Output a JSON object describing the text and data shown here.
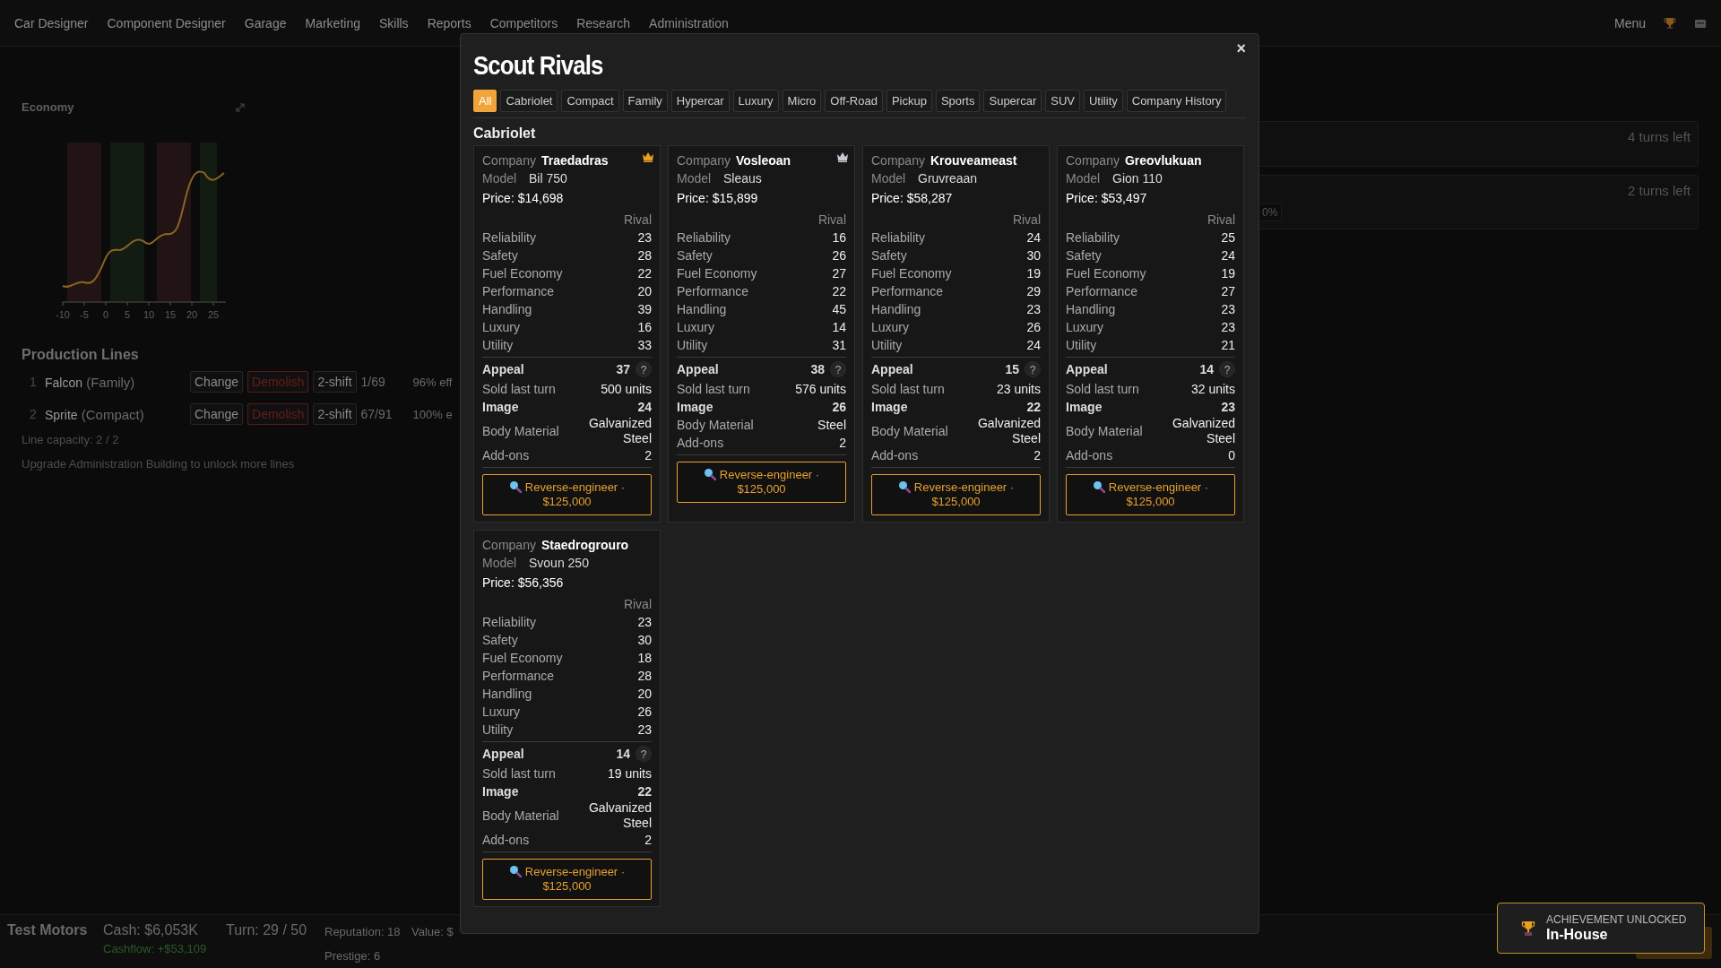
{
  "nav": {
    "items": [
      "Car Designer",
      "Component Designer",
      "Garage",
      "Marketing",
      "Skills",
      "Reports",
      "Competitors",
      "Research",
      "Administration"
    ],
    "menu": "Menu"
  },
  "economy": {
    "title": "Economy",
    "x_tick_labels": [
      "-10",
      "-5",
      "0",
      "5",
      "10",
      "15",
      "20",
      "25"
    ]
  },
  "production_lines": {
    "title": "Production Lines",
    "lines": [
      {
        "number": "1",
        "name": "Falcon",
        "class": "(Family)",
        "change": "Change",
        "demolish": "Demolish",
        "shift": "2-shift",
        "count": "1/69",
        "efficiency": "96% eff"
      },
      {
        "number": "2",
        "name": "Sprite",
        "class": "(Compact)",
        "change": "Change",
        "demolish": "Demolish",
        "shift": "2-shift",
        "count": "67/91",
        "efficiency": "100% e"
      }
    ],
    "capacity": "Line capacity: 2 / 2",
    "hint": "Upgrade Administration Building to unlock more lines"
  },
  "tasks": [
    {
      "turns_left": "4 turns left"
    },
    {
      "turns_left": "2 turns left",
      "tag": "0%"
    }
  ],
  "status_bar": {
    "company": "Test Motors",
    "cash": "Cash: $6,053K",
    "cashflow": "Cashflow: +$53,109",
    "turn": "Turn: 29 / 50",
    "reputation": "Reputation: 18",
    "prestige": "Prestige: 6",
    "value": "Value: $"
  },
  "modal": {
    "title": "Scout Rivals",
    "close": "×",
    "section": "Cabriolet",
    "tabs": [
      {
        "label": "All",
        "selected": true
      },
      {
        "label": "Cabriolet",
        "selected": false
      },
      {
        "label": "Compact",
        "selected": false
      },
      {
        "label": "Family",
        "selected": false
      },
      {
        "label": "Hypercar",
        "selected": false
      },
      {
        "label": "Luxury",
        "selected": false
      },
      {
        "label": "Micro",
        "selected": false
      },
      {
        "label": "Off-Road",
        "selected": false
      },
      {
        "label": "Pickup",
        "selected": false
      },
      {
        "label": "Sports",
        "selected": false
      },
      {
        "label": "Supercar",
        "selected": false
      },
      {
        "label": "SUV",
        "selected": false
      },
      {
        "label": "Utility",
        "selected": false
      },
      {
        "label": "Company History",
        "selected": false
      }
    ],
    "cards": [
      {
        "company_label": "Company",
        "company": "Traedadras",
        "model_label": "Model",
        "model": "Bil 750",
        "price": "Price: $14,698",
        "color": "#e8a020",
        "rival_header": "Rival",
        "stats": [
          {
            "label": "Reliability",
            "value": "23"
          },
          {
            "label": "Safety",
            "value": "28"
          },
          {
            "label": "Fuel Economy",
            "value": "22"
          },
          {
            "label": "Performance",
            "value": "20"
          },
          {
            "label": "Handling",
            "value": "39"
          },
          {
            "label": "Luxury",
            "value": "16"
          },
          {
            "label": "Utility",
            "value": "33"
          }
        ],
        "appeal_label": "Appeal",
        "appeal": "37",
        "help": "?",
        "sold_label": "Sold last turn",
        "sold": "500 units",
        "image_label": "Image",
        "image": "24",
        "body_label": "Body Material",
        "body": "Galvanized Steel",
        "addons_label": "Add-ons",
        "addons": "2",
        "button": "Reverse-engineer · $125,000"
      },
      {
        "company_label": "Company",
        "company": "Vosleoan",
        "model_label": "Model",
        "model": "Sleaus",
        "price": "Price: $15,899",
        "color": "#c8c8d2",
        "rival_header": "Rival",
        "stats": [
          {
            "label": "Reliability",
            "value": "16"
          },
          {
            "label": "Safety",
            "value": "26"
          },
          {
            "label": "Fuel Economy",
            "value": "27"
          },
          {
            "label": "Performance",
            "value": "22"
          },
          {
            "label": "Handling",
            "value": "45"
          },
          {
            "label": "Luxury",
            "value": "14"
          },
          {
            "label": "Utility",
            "value": "31"
          }
        ],
        "appeal_label": "Appeal",
        "appeal": "38",
        "help": "?",
        "sold_label": "Sold last turn",
        "sold": "576 units",
        "image_label": "Image",
        "image": "26",
        "body_label": "Body Material",
        "body": "Steel",
        "addons_label": "Add-ons",
        "addons": "2",
        "button": "Reverse-engineer · $125,000"
      },
      {
        "company_label": "Company",
        "company": "Krouveameast",
        "model_label": "Model",
        "model": "Gruvreaan",
        "price": "Price: $58,287",
        "rival_header": "Rival",
        "stats": [
          {
            "label": "Reliability",
            "value": "24"
          },
          {
            "label": "Safety",
            "value": "30"
          },
          {
            "label": "Fuel Economy",
            "value": "19"
          },
          {
            "label": "Performance",
            "value": "29"
          },
          {
            "label": "Handling",
            "value": "23"
          },
          {
            "label": "Luxury",
            "value": "26"
          },
          {
            "label": "Utility",
            "value": "24"
          }
        ],
        "appeal_label": "Appeal",
        "appeal": "15",
        "help": "?",
        "sold_label": "Sold last turn",
        "sold": "23 units",
        "image_label": "Image",
        "image": "22",
        "body_label": "Body Material",
        "body": "Galvanized Steel",
        "addons_label": "Add-ons",
        "addons": "2",
        "button": "Reverse-engineer · $125,000"
      },
      {
        "company_label": "Company",
        "company": "Greovlukuan",
        "model_label": "Model",
        "model": "Gion 110",
        "price": "Price: $53,497",
        "rival_header": "Rival",
        "stats": [
          {
            "label": "Reliability",
            "value": "25"
          },
          {
            "label": "Safety",
            "value": "24"
          },
          {
            "label": "Fuel Economy",
            "value": "19"
          },
          {
            "label": "Performance",
            "value": "27"
          },
          {
            "label": "Handling",
            "value": "23"
          },
          {
            "label": "Luxury",
            "value": "23"
          },
          {
            "label": "Utility",
            "value": "21"
          }
        ],
        "appeal_label": "Appeal",
        "appeal": "14",
        "help": "?",
        "sold_label": "Sold last turn",
        "sold": "32 units",
        "image_label": "Image",
        "image": "23",
        "body_label": "Body Material",
        "body": "Galvanized Steel",
        "addons_label": "Add-ons",
        "addons": "0",
        "button": "Reverse-engineer · $125,000"
      },
      {
        "company_label": "Company",
        "company": "Staedrogrouro",
        "model_label": "Model",
        "model": "Svoun 250",
        "price": "Price: $56,356",
        "rival_header": "Rival",
        "stats": [
          {
            "label": "Reliability",
            "value": "23"
          },
          {
            "label": "Safety",
            "value": "30"
          },
          {
            "label": "Fuel Economy",
            "value": "18"
          },
          {
            "label": "Performance",
            "value": "28"
          },
          {
            "label": "Handling",
            "value": "20"
          },
          {
            "label": "Luxury",
            "value": "26"
          },
          {
            "label": "Utility",
            "value": "23"
          }
        ],
        "appeal_label": "Appeal",
        "appeal": "14",
        "help": "?",
        "sold_label": "Sold last turn",
        "sold": "19 units",
        "image_label": "Image",
        "image": "22",
        "body_label": "Body Material",
        "body": "Galvanized Steel",
        "addons_label": "Add-ons",
        "addons": "2",
        "button": "Reverse-engineer · $125,000"
      }
    ]
  },
  "toast": {
    "heading": "ACHIEVEMENT UNLOCKED",
    "title": "In-House"
  }
}
